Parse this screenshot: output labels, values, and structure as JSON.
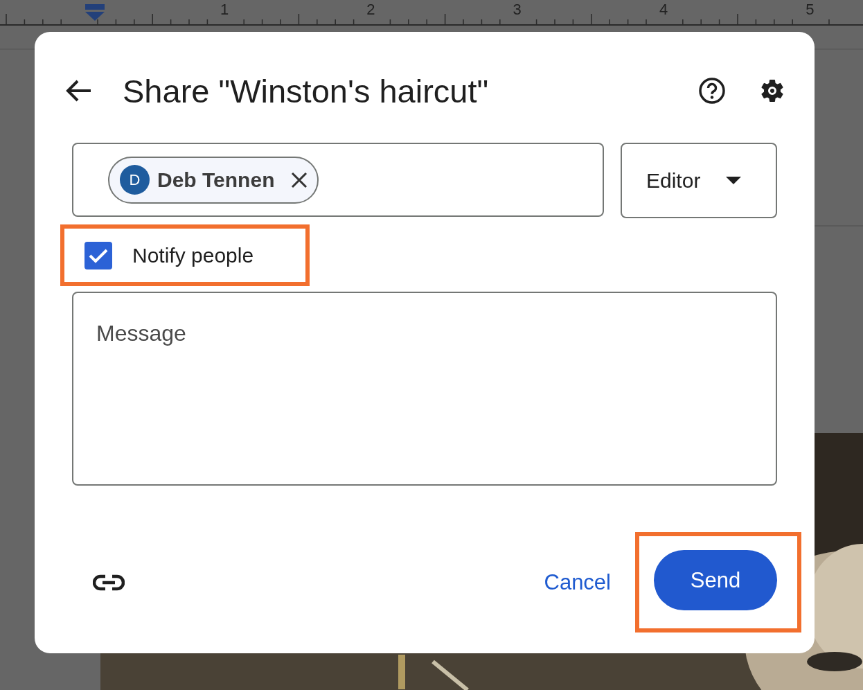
{
  "ruler": {
    "numbers": [
      "1",
      "2",
      "3",
      "4",
      "5"
    ]
  },
  "dialog": {
    "title": "Share \"Winston's haircut\"",
    "recipients": [
      {
        "initial": "D",
        "name": "Deb Tennen"
      }
    ],
    "role": "Editor",
    "notify": {
      "label": "Notify people",
      "checked": true,
      "highlighted": true
    },
    "message": {
      "placeholder": "Message"
    },
    "actions": {
      "cancel": "Cancel",
      "send": {
        "label": "Send",
        "highlighted": true
      }
    }
  }
}
